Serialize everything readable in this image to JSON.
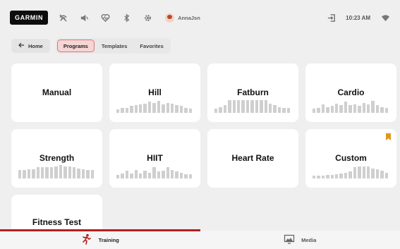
{
  "brand": {
    "logo": "GARMIN"
  },
  "status_bar": {
    "icons": [
      "no-signal-icon",
      "mute-icon",
      "heart-rate-icon",
      "bluetooth-icon",
      "settings-icon"
    ],
    "username": "AnnaJsn",
    "time": "10:23 AM"
  },
  "nav": {
    "home_label": "Home",
    "tabs": [
      {
        "label": "Programs",
        "active": true
      },
      {
        "label": "Templates",
        "active": false
      },
      {
        "label": "Favorites",
        "active": false
      }
    ]
  },
  "programs": [
    {
      "title": "Manual"
    },
    {
      "title": "Hill"
    },
    {
      "title": "Fatburn"
    },
    {
      "title": "Cardio"
    },
    {
      "title": "Strength"
    },
    {
      "title": "HIIT"
    },
    {
      "title": "Heart Rate"
    },
    {
      "title": "Custom",
      "bookmarked": true
    },
    {
      "title": "Fitness Test"
    }
  ],
  "bottom_nav": {
    "tabs": [
      {
        "label": "Training",
        "icon": "running-person-icon",
        "active": true
      },
      {
        "label": "Media",
        "icon": "media-screen-icon",
        "active": false
      }
    ]
  },
  "colors": {
    "accent": "#b51f1f",
    "tab_active_bg": "#f6d5d5",
    "bookmark": "#e1961f",
    "bar": "#cfcfcf",
    "background": "#efefef"
  }
}
